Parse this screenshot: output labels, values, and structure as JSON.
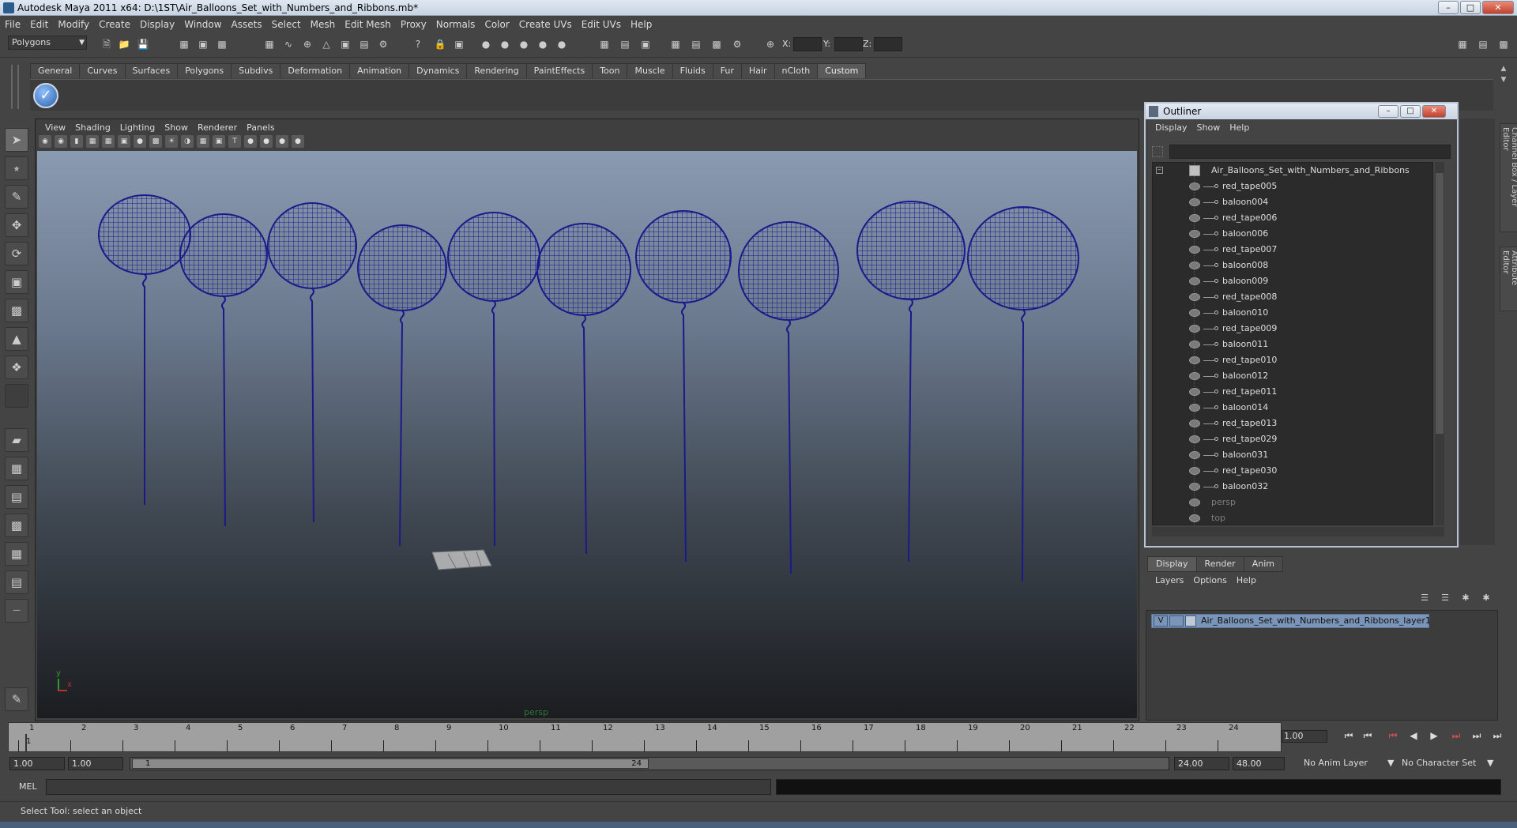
{
  "window": {
    "title": "Autodesk Maya 2011 x64: D:\\1ST\\Air_Balloons_Set_with_Numbers_and_Ribbons.mb*",
    "minimize_icon": "minimize-icon",
    "maximize_icon": "maximize-icon",
    "close_icon": "close-icon"
  },
  "menubar": [
    "File",
    "Edit",
    "Modify",
    "Create",
    "Display",
    "Window",
    "Assets",
    "Select",
    "Mesh",
    "Edit Mesh",
    "Proxy",
    "Normals",
    "Color",
    "Create UVs",
    "Edit UVs",
    "Help"
  ],
  "statusline": {
    "mode": "Polygons",
    "x_label": "X:",
    "y_label": "Y:",
    "z_label": "Z:"
  },
  "shelf": {
    "tabs": [
      "General",
      "Curves",
      "Surfaces",
      "Polygons",
      "Subdivs",
      "Deformation",
      "Animation",
      "Dynamics",
      "Rendering",
      "PaintEffects",
      "Toon",
      "Muscle",
      "Fluids",
      "Fur",
      "Hair",
      "nCloth",
      "Custom"
    ],
    "active_tab": "Custom"
  },
  "viewport": {
    "menu": [
      "View",
      "Shading",
      "Lighting",
      "Show",
      "Renderer",
      "Panels"
    ],
    "camera_label": "persp",
    "axis_y": "y",
    "axis_x": "x",
    "wire_color": "#1a1a8a"
  },
  "outliner": {
    "title": "Outliner",
    "menu": [
      "Display",
      "Show",
      "Help"
    ],
    "root": "Air_Balloons_Set_with_Numbers_and_Ribbons",
    "items": [
      "red_tape005",
      "baloon004",
      "red_tape006",
      "baloon006",
      "red_tape007",
      "baloon008",
      "baloon009",
      "red_tape008",
      "baloon010",
      "red_tape009",
      "baloon011",
      "red_tape010",
      "baloon012",
      "red_tape011",
      "baloon014",
      "red_tape013",
      "red_tape029",
      "baloon031",
      "red_tape030",
      "baloon032"
    ],
    "cameras": [
      "persp",
      "top"
    ]
  },
  "side_tabs": {
    "channel_box": "Channel Box / Layer Editor",
    "attribute_editor": "Attribute Editor"
  },
  "layer_editor": {
    "tabs": [
      "Display",
      "Render",
      "Anim"
    ],
    "active_tab": "Display",
    "menu": [
      "Layers",
      "Options",
      "Help"
    ],
    "layer_visible": "V",
    "layer_name": "Air_Balloons_Set_with_Numbers_and_Ribbons_layer1"
  },
  "timeslider": {
    "ticks": [
      "1",
      "2",
      "3",
      "4",
      "5",
      "6",
      "7",
      "8",
      "9",
      "10",
      "11",
      "12",
      "13",
      "14",
      "15",
      "16",
      "17",
      "18",
      "19",
      "20",
      "21",
      "22",
      "23",
      "24"
    ],
    "current_frame": "1",
    "frame_field": "1.00"
  },
  "range": {
    "start": "1.00",
    "current": "1.00",
    "handle_start": "1",
    "handle_end": "24",
    "end": "24.00",
    "anim_end": "48.00",
    "anim_layer": "No Anim Layer",
    "character_set": "No Character Set"
  },
  "cmdline": {
    "label": "MEL"
  },
  "helpline": {
    "text": "Select Tool: select an object"
  }
}
